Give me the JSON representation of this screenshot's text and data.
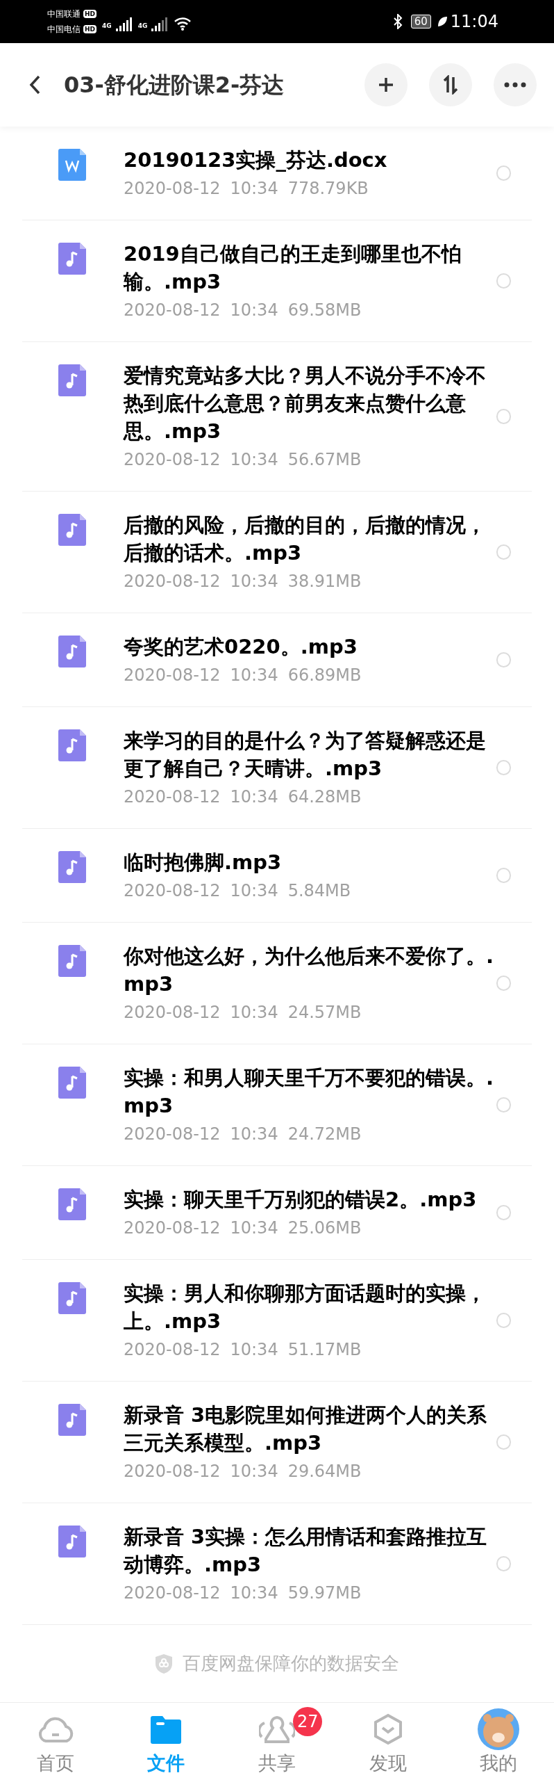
{
  "status_bar": {
    "carrier_1": "中国联通",
    "carrier_2": "中国电信",
    "hd_1": "HD",
    "hd_2": "HD",
    "net_1": "4G",
    "net_2": "4G",
    "battery": "60",
    "time": "11:04"
  },
  "header": {
    "title": "03-舒化进阶课2-芬达"
  },
  "files": [
    {
      "kind": "doc",
      "name": "20190123实操_芬达.docx",
      "date": "2020-08-12",
      "time": "10:34",
      "size": "778.79KB",
      "selected": false
    },
    {
      "kind": "audio",
      "name": "2019自己做自己的王走到哪里也不怕输。.mp3",
      "date": "2020-08-12",
      "time": "10:34",
      "size": "69.58MB",
      "selected": false
    },
    {
      "kind": "audio",
      "name": "爱情究竟站多大比？男人不说分手不冷不热到底什么意思？前男友来点赞什么意思。.mp3",
      "date": "2020-08-12",
      "time": "10:34",
      "size": "56.67MB",
      "selected": false
    },
    {
      "kind": "audio",
      "name": "后撤的风险，后撤的目的，后撤的情况，后撤的话术。.mp3",
      "date": "2020-08-12",
      "time": "10:34",
      "size": "38.91MB",
      "selected": false
    },
    {
      "kind": "audio",
      "name": "夸奖的艺术0220。.mp3",
      "date": "2020-08-12",
      "time": "10:34",
      "size": "66.89MB",
      "selected": false
    },
    {
      "kind": "audio",
      "name": "来学习的目的是什么？为了答疑解惑还是更了解自己？天晴讲。.mp3",
      "date": "2020-08-12",
      "time": "10:34",
      "size": "64.28MB",
      "selected": false
    },
    {
      "kind": "audio",
      "name": "临时抱佛脚.mp3",
      "date": "2020-08-12",
      "time": "10:34",
      "size": "5.84MB",
      "selected": false
    },
    {
      "kind": "audio",
      "name": "你对他这么好，为什么他后来不爱你了。.mp3",
      "date": "2020-08-12",
      "time": "10:34",
      "size": "24.57MB",
      "selected": false
    },
    {
      "kind": "audio",
      "name": "实操：和男人聊天里千万不要犯的错误。.mp3",
      "date": "2020-08-12",
      "time": "10:34",
      "size": "24.72MB",
      "selected": false
    },
    {
      "kind": "audio",
      "name": "实操：聊天里千万别犯的错误2。.mp3",
      "date": "2020-08-12",
      "time": "10:34",
      "size": "25.06MB",
      "selected": false
    },
    {
      "kind": "audio",
      "name": "实操：男人和你聊那方面话题时的实操，上。.mp3",
      "date": "2020-08-12",
      "time": "10:34",
      "size": "51.17MB",
      "selected": false
    },
    {
      "kind": "audio",
      "name": "新录音 3电影院里如何推进两个人的关系三元关系模型。.mp3",
      "date": "2020-08-12",
      "time": "10:34",
      "size": "29.64MB",
      "selected": false
    },
    {
      "kind": "audio",
      "name": "新录音 3实操：怎么用情话和套路推拉互动博弈。.mp3",
      "date": "2020-08-12",
      "time": "10:34",
      "size": "59.97MB",
      "selected": false
    }
  ],
  "footer_note": "百度网盘保障你的数据安全",
  "tabs": [
    {
      "kind": "home",
      "label": "首页",
      "selected": false
    },
    {
      "kind": "files",
      "label": "文件",
      "selected": true
    },
    {
      "kind": "share",
      "label": "共享",
      "selected": false,
      "badge": "27"
    },
    {
      "kind": "discover",
      "label": "发现",
      "selected": false
    },
    {
      "kind": "profile",
      "label": "我的",
      "selected": false
    }
  ]
}
